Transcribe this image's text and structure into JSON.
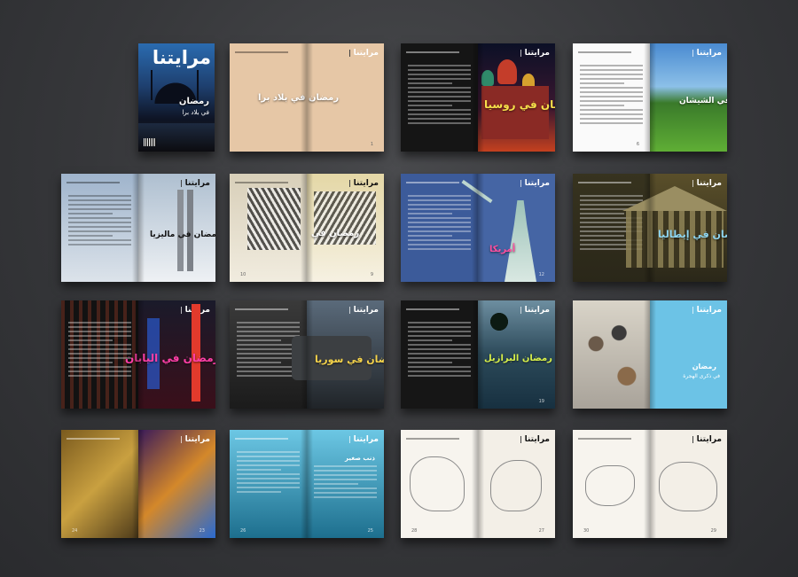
{
  "magazine": {
    "logo_text": "مرايتنا",
    "cover_headline": "رمضان",
    "cover_subline": "في بلاد برا"
  },
  "spreads": [
    {
      "id": "s1",
      "kind": "cover",
      "headline": ""
    },
    {
      "id": "s2",
      "kind": "spread",
      "headline": "رمضان في بلاد برا",
      "page_right": "1"
    },
    {
      "id": "s3",
      "kind": "spread",
      "headline": "رمضان في روسيا",
      "page_right": "3"
    },
    {
      "id": "s4",
      "kind": "spread",
      "headline": "رمضان في الشيشان",
      "page_right": "6"
    },
    {
      "id": "s5",
      "kind": "spread",
      "headline": "رمضان في ماليزيا",
      "page_left": "",
      "page_right": ""
    },
    {
      "id": "s6",
      "kind": "spread",
      "headline": "رمضان في",
      "page_left": "10",
      "page_right": "9"
    },
    {
      "id": "s7",
      "kind": "spread",
      "headline": "أمريكا",
      "page_left": "",
      "page_right": "12"
    },
    {
      "id": "s8",
      "kind": "spread",
      "headline": "رمضان في إيطاليا",
      "page_left": "",
      "page_right": ""
    },
    {
      "id": "s9",
      "kind": "spread",
      "headline": "رمضان في اليابان",
      "page_left": "",
      "page_right": ""
    },
    {
      "id": "s10",
      "kind": "spread",
      "headline": "رمضان في سوريا",
      "page_left": "",
      "page_right": ""
    },
    {
      "id": "s11",
      "kind": "spread",
      "headline": "رمضان البرازيل",
      "page_left": "",
      "page_right": "19"
    },
    {
      "id": "s12",
      "kind": "spread",
      "headline": "رمضان",
      "subline": "في ذكرى الهجرة",
      "page_left": "",
      "page_right": ""
    },
    {
      "id": "s13",
      "kind": "spread",
      "headline": "",
      "page_left": "24",
      "page_right": "23"
    },
    {
      "id": "s14",
      "kind": "spread",
      "headline": "ذنب صغير",
      "page_left": "26",
      "page_right": "25"
    },
    {
      "id": "s15",
      "kind": "spread",
      "headline": "",
      "page_left": "28",
      "page_right": "27"
    },
    {
      "id": "s16",
      "kind": "spread",
      "headline": "",
      "page_left": "30",
      "page_right": "29"
    }
  ],
  "colors": {
    "background": "#36373a",
    "beige": "#e8c9a8",
    "teal": "#3fb6d9",
    "navy": "#3a5a9c",
    "paper": "#f5f1ea"
  }
}
